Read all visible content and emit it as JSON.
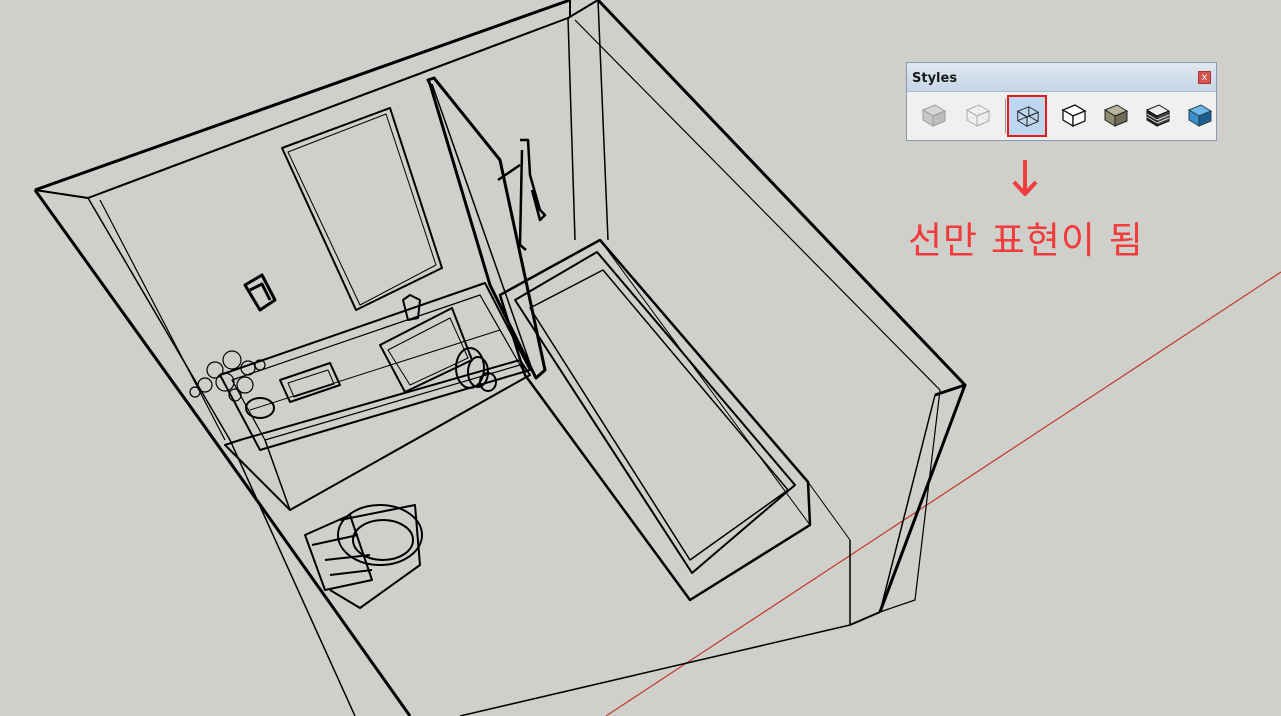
{
  "styles_panel": {
    "title": "Styles",
    "close_label": "x",
    "buttons": [
      {
        "name": "xray-style-icon",
        "selected": false
      },
      {
        "name": "back-edges-style-icon",
        "selected": false
      },
      {
        "name": "wireframe-style-icon",
        "selected": true
      },
      {
        "name": "hidden-line-style-icon",
        "selected": false
      },
      {
        "name": "shaded-style-icon",
        "selected": false
      },
      {
        "name": "shaded-with-textures-style-icon",
        "selected": false
      },
      {
        "name": "monochrome-style-icon",
        "selected": false
      }
    ]
  },
  "annotation": {
    "text": "선만 표현이 됨",
    "color": "#f23b3b"
  },
  "colors": {
    "background": "#cfcfcb",
    "selected_highlight": "#e01b1b",
    "axis_red": "#c0392b"
  }
}
